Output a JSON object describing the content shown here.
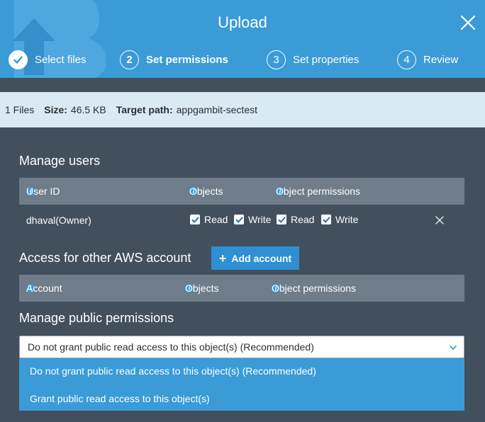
{
  "header": {
    "title": "Upload",
    "steps": [
      {
        "label": "Select files",
        "num": ""
      },
      {
        "label": "Set permissions",
        "num": "2"
      },
      {
        "label": "Set properties",
        "num": "3"
      },
      {
        "label": "Review",
        "num": "4"
      }
    ]
  },
  "info": {
    "files": "1 Files",
    "size_label": "Size:",
    "size_value": "46.5 KB",
    "target_label": "Target path:",
    "target_value": "appgambit-sectest"
  },
  "manage_users": {
    "title": "Manage users",
    "columns": [
      "User ID",
      "Objects",
      "Object permissions"
    ],
    "row": {
      "user": "dhaval(Owner)",
      "checks": [
        "Read",
        "Write",
        "Read",
        "Write"
      ]
    }
  },
  "other_accounts": {
    "title": "Access for other AWS account",
    "add_button": "Add account",
    "columns": [
      "Account",
      "Objects",
      "Object permissions"
    ]
  },
  "public": {
    "title": "Manage public permissions",
    "selected": "Do not grant public read access to this object(s) (Recommended)",
    "options": [
      "Do not grant public read access to this object(s) (Recommended)",
      "Grant public read access to this object(s)"
    ]
  },
  "colors": {
    "header_blue": "#3a9bd7",
    "panel": "#42505e",
    "table_head": "#6f7d8a",
    "info_bar": "#d9eaf5",
    "button_blue": "#2f8fd3"
  }
}
